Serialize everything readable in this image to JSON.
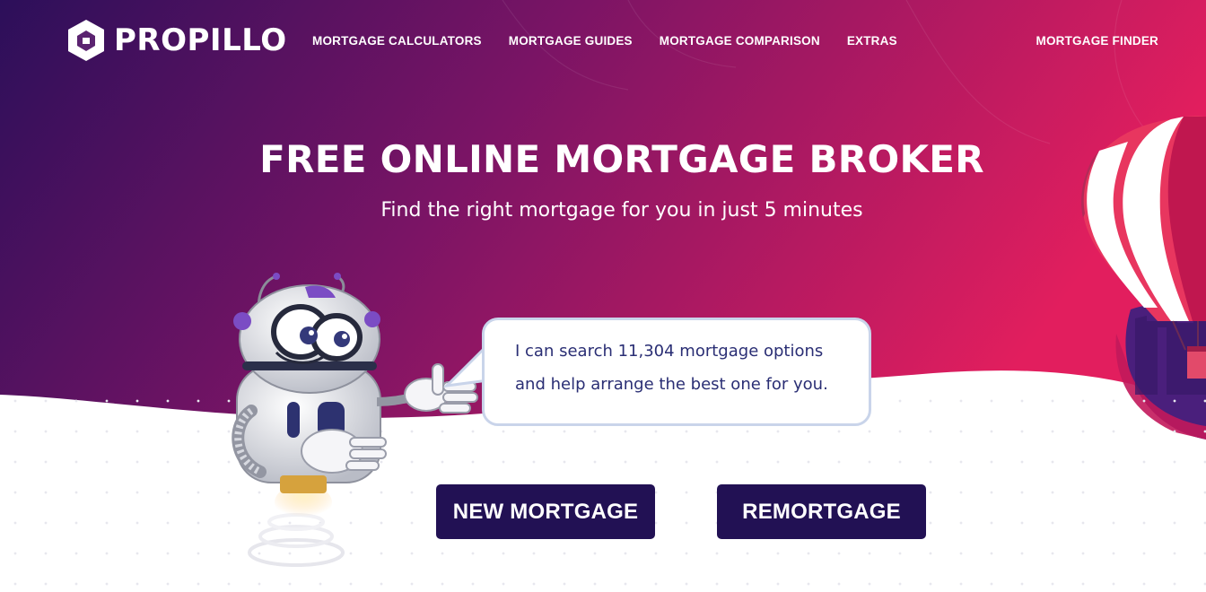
{
  "brand": {
    "name": "PROPILLO"
  },
  "nav": {
    "items": [
      {
        "label": "MORTGAGE CALCULATORS"
      },
      {
        "label": "MORTGAGE GUIDES"
      },
      {
        "label": "MORTGAGE COMPARISON"
      },
      {
        "label": "EXTRAS"
      }
    ],
    "right_label": "MORTGAGE FINDER"
  },
  "hero": {
    "title": "FREE ONLINE MORTGAGE BROKER",
    "subtitle": "Find the right mortgage for you in just 5 minutes"
  },
  "bubble": {
    "line1": "I can search 11,304 mortgage options",
    "line2": "and help arrange the best one for you."
  },
  "buttons": {
    "new_mortgage": "NEW MORTGAGE",
    "remortgage": "REMORTGAGE"
  },
  "colors": {
    "gradient_start": "#2c0f5a",
    "gradient_end": "#e21e5e",
    "button_bg": "#221154",
    "bubble_text": "#2a2e74"
  },
  "icons": {
    "logo": "propillo-hexagon-logo",
    "mascot": "robot-mascot",
    "decoration": "hot-air-balloon"
  }
}
